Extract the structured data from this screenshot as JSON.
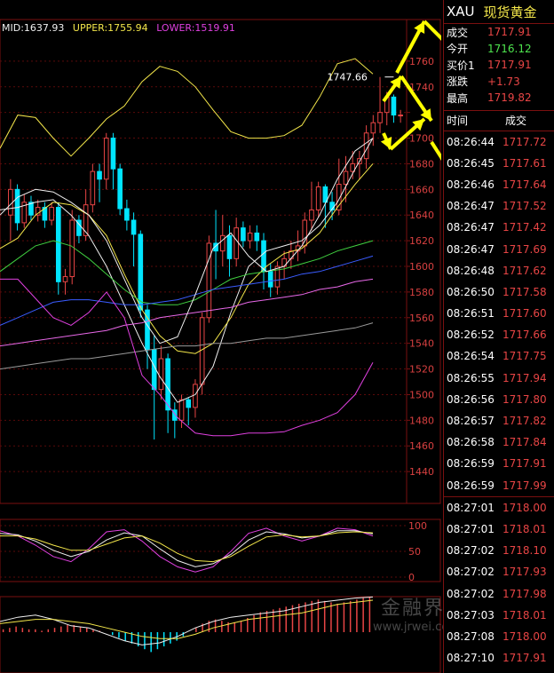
{
  "legend": {
    "mid": "MID:1637.93",
    "upper": "UPPER:1755.94",
    "lower": "LOWER:1519.91",
    "mid_color": "#f0f0f0",
    "upper_color": "#f3e64a",
    "lower_color": "#e040e0"
  },
  "symbol": "XAU",
  "symbol_name": "现货黄金",
  "quote": [
    {
      "label": "成交",
      "value": "1717.91",
      "color": "#e84545"
    },
    {
      "label": "今开",
      "value": "1716.12",
      "color": "#4ee44e"
    },
    {
      "label": "买价1",
      "value": "1717.91",
      "color": "#e84545"
    },
    {
      "label": "涨跌",
      "value": "+1.73",
      "color": "#e84545"
    },
    {
      "label": "最高",
      "value": "1719.82",
      "color": "#e84545"
    }
  ],
  "trades_header": {
    "time": "时间",
    "price": "成交"
  },
  "trades": [
    {
      "time": "08:26:44",
      "price": "1717.72"
    },
    {
      "time": "08:26:45",
      "price": "1717.61"
    },
    {
      "time": "08:26:46",
      "price": "1717.64"
    },
    {
      "time": "08:26:47",
      "price": "1717.52"
    },
    {
      "time": "08:26:47",
      "price": "1717.42"
    },
    {
      "time": "08:26:47",
      "price": "1717.69"
    },
    {
      "time": "08:26:48",
      "price": "1717.62"
    },
    {
      "time": "08:26:50",
      "price": "1717.58"
    },
    {
      "time": "08:26:51",
      "price": "1717.60"
    },
    {
      "time": "08:26:52",
      "price": "1717.66"
    },
    {
      "time": "08:26:54",
      "price": "1717.75"
    },
    {
      "time": "08:26:55",
      "price": "1717.94"
    },
    {
      "time": "08:26:56",
      "price": "1717.80"
    },
    {
      "time": "08:26:57",
      "price": "1717.82"
    },
    {
      "time": "08:26:58",
      "price": "1717.84"
    },
    {
      "time": "08:26:59",
      "price": "1717.91"
    },
    {
      "time": "08:26:59",
      "price": "1717.99"
    },
    {
      "time": "08:27:01",
      "price": "1718.00"
    },
    {
      "time": "08:27:01",
      "price": "1718.01"
    },
    {
      "time": "08:27:02",
      "price": "1718.10"
    },
    {
      "time": "08:27:02",
      "price": "1717.93"
    },
    {
      "time": "08:27:02",
      "price": "1717.98"
    },
    {
      "time": "08:27:03",
      "price": "1718.01"
    },
    {
      "time": "08:27:08",
      "price": "1718.00"
    },
    {
      "time": "08:27:10",
      "price": "1717.91"
    }
  ],
  "watermark": {
    "name": "金融界",
    "url": "www.jrwei.com"
  },
  "chart_data": {
    "type": "candlestick",
    "ylim": [
      1420,
      1780
    ],
    "yticks": [
      1440,
      1460,
      1480,
      1500,
      1520,
      1540,
      1560,
      1580,
      1600,
      1620,
      1640,
      1660,
      1680,
      1700,
      1720,
      1740,
      1760
    ],
    "ytick_labels": [
      "1440",
      "1460",
      "1480",
      "1500",
      "1520",
      "1540",
      "1560",
      "1580",
      "1600",
      "1620",
      "1640",
      "1660",
      "1680",
      "1700",
      "",
      "1740",
      "1760"
    ],
    "high_annotation": {
      "value": 1747.66,
      "label": "1747.66",
      "index": 56
    },
    "colors": {
      "up": "#e84545",
      "down": "#00e5ff",
      "upper": "#f3e64a",
      "mid": "#f0f0f0",
      "lower": "#e040e0"
    },
    "candles": [
      [
        1640,
        1660,
        1620,
        1668
      ],
      [
        1660,
        1634,
        1628,
        1664
      ],
      [
        1634,
        1650,
        1630,
        1656
      ],
      [
        1650,
        1640,
        1636,
        1655
      ],
      [
        1640,
        1646,
        1635,
        1652
      ],
      [
        1646,
        1636,
        1630,
        1650
      ],
      [
        1636,
        1646,
        1632,
        1650
      ],
      [
        1646,
        1588,
        1578,
        1650
      ],
      [
        1588,
        1592,
        1578,
        1598
      ],
      [
        1592,
        1636,
        1586,
        1644
      ],
      [
        1636,
        1624,
        1618,
        1640
      ],
      [
        1624,
        1648,
        1620,
        1660
      ],
      [
        1648,
        1674,
        1642,
        1680
      ],
      [
        1674,
        1668,
        1650,
        1680
      ],
      [
        1668,
        1700,
        1660,
        1704
      ],
      [
        1700,
        1676,
        1660,
        1704
      ],
      [
        1676,
        1645,
        1640,
        1680
      ],
      [
        1645,
        1636,
        1628,
        1652
      ],
      [
        1636,
        1625,
        1600,
        1642
      ],
      [
        1625,
        1566,
        1560,
        1628
      ],
      [
        1566,
        1535,
        1520,
        1570
      ],
      [
        1535,
        1504,
        1465,
        1546
      ],
      [
        1504,
        1528,
        1496,
        1538
      ],
      [
        1528,
        1488,
        1470,
        1532
      ],
      [
        1488,
        1480,
        1466,
        1494
      ],
      [
        1480,
        1496,
        1474,
        1500
      ],
      [
        1496,
        1490,
        1476,
        1498
      ],
      [
        1490,
        1508,
        1482,
        1512
      ],
      [
        1508,
        1560,
        1500,
        1564
      ],
      [
        1560,
        1618,
        1556,
        1624
      ],
      [
        1618,
        1612,
        1590,
        1644
      ],
      [
        1612,
        1624,
        1600,
        1640
      ],
      [
        1624,
        1606,
        1592,
        1632
      ],
      [
        1606,
        1630,
        1600,
        1638
      ],
      [
        1630,
        1620,
        1615,
        1635
      ],
      [
        1620,
        1626,
        1614,
        1632
      ],
      [
        1626,
        1620,
        1612,
        1632
      ],
      [
        1620,
        1596,
        1582,
        1626
      ],
      [
        1596,
        1584,
        1576,
        1602
      ],
      [
        1584,
        1600,
        1578,
        1604
      ],
      [
        1600,
        1606,
        1590,
        1612
      ],
      [
        1606,
        1612,
        1598,
        1620
      ],
      [
        1612,
        1616,
        1604,
        1628
      ],
      [
        1616,
        1636,
        1610,
        1642
      ],
      [
        1636,
        1644,
        1628,
        1666
      ],
      [
        1644,
        1662,
        1638,
        1666
      ],
      [
        1662,
        1650,
        1630,
        1664
      ],
      [
        1650,
        1644,
        1636,
        1658
      ],
      [
        1644,
        1664,
        1640,
        1684
      ],
      [
        1664,
        1674,
        1650,
        1686
      ],
      [
        1674,
        1680,
        1668,
        1690
      ],
      [
        1680,
        1684,
        1668,
        1690
      ],
      [
        1684,
        1704,
        1676,
        1710
      ],
      [
        1704,
        1712,
        1694,
        1718
      ],
      [
        1712,
        1720,
        1704,
        1747.66
      ],
      [
        1720,
        1732,
        1710,
        1736
      ],
      [
        1732,
        1718,
        1712,
        1734
      ],
      [
        1718,
        1718,
        1712,
        1722
      ]
    ],
    "bands": {
      "upper": [
        1692,
        1718,
        1716,
        1700,
        1686,
        1700,
        1715,
        1725,
        1744,
        1756,
        1752,
        1740,
        1722,
        1705,
        1700,
        1700,
        1702,
        1710,
        1732,
        1758,
        1762,
        1750
      ],
      "mid": [
        1640,
        1654,
        1660,
        1658,
        1650,
        1640,
        1620,
        1590,
        1560,
        1540,
        1545,
        1578,
        1614,
        1626,
        1608,
        1596,
        1600,
        1616,
        1640,
        1668,
        1690,
        1700
      ],
      "lower": [
        1590,
        1590,
        1575,
        1560,
        1554,
        1564,
        1580,
        1560,
        1515,
        1500,
        1482,
        1470,
        1468,
        1468,
        1470,
        1470,
        1471,
        1476,
        1480,
        1486,
        1500,
        1525
      ]
    },
    "ma_lines": [
      {
        "color": "#f0f0f0",
        "values": [
          1644,
          1646,
          1650,
          1652,
          1640,
          1624,
          1600,
          1570,
          1540,
          1514,
          1494,
          1500,
          1522,
          1564,
          1600,
          1612,
          1616,
          1620,
          1632,
          1650,
          1676,
          1700
        ]
      },
      {
        "color": "#f3e64a",
        "values": [
          1614,
          1622,
          1640,
          1650,
          1648,
          1640,
          1624,
          1594,
          1566,
          1546,
          1534,
          1532,
          1540,
          1560,
          1586,
          1600,
          1610,
          1614,
          1626,
          1646,
          1664,
          1680
        ]
      },
      {
        "color": "#40d040",
        "values": [
          1596,
          1606,
          1616,
          1620,
          1616,
          1606,
          1594,
          1582,
          1572,
          1570,
          1570,
          1574,
          1582,
          1590,
          1594,
          1596,
          1598,
          1602,
          1606,
          1612,
          1616,
          1620
        ]
      },
      {
        "color": "#3a5cff",
        "values": [
          1554,
          1560,
          1566,
          1572,
          1574,
          1574,
          1572,
          1570,
          1570,
          1572,
          1574,
          1578,
          1582,
          1584,
          1586,
          1588,
          1590,
          1594,
          1596,
          1600,
          1604,
          1608
        ]
      },
      {
        "color": "#e868e8",
        "values": [
          1538,
          1540,
          1542,
          1544,
          1546,
          1548,
          1550,
          1554,
          1556,
          1560,
          1562,
          1564,
          1566,
          1568,
          1572,
          1574,
          1576,
          1578,
          1582,
          1584,
          1588,
          1590
        ]
      },
      {
        "color": "#9a9a9a",
        "values": [
          1520,
          1522,
          1524,
          1526,
          1528,
          1528,
          1530,
          1532,
          1534,
          1536,
          1538,
          1538,
          1540,
          1540,
          1542,
          1544,
          1544,
          1546,
          1548,
          1550,
          1552,
          1556
        ]
      }
    ],
    "osc_ticks": [
      {
        "value": 100,
        "label": "100"
      },
      {
        "value": 50,
        "label": "50"
      },
      {
        "value": 0,
        "label": "0"
      }
    ],
    "osc_lines": [
      {
        "color": "#e040e0",
        "values": [
          90,
          80,
          62,
          40,
          30,
          55,
          88,
          92,
          70,
          40,
          20,
          10,
          20,
          50,
          85,
          95,
          80,
          70,
          80,
          95,
          92,
          80
        ]
      },
      {
        "color": "#f0f0f0",
        "values": [
          85,
          82,
          70,
          52,
          40,
          50,
          72,
          86,
          80,
          55,
          32,
          20,
          26,
          44,
          72,
          88,
          84,
          76,
          80,
          90,
          90,
          84
        ]
      },
      {
        "color": "#f3e64a",
        "values": [
          80,
          80,
          74,
          62,
          52,
          52,
          64,
          76,
          80,
          66,
          46,
          32,
          30,
          40,
          60,
          78,
          82,
          78,
          80,
          86,
          88,
          86
        ]
      }
    ],
    "macd": [
      2,
      3,
      4,
      3,
      2,
      2,
      1,
      2,
      3,
      4,
      5,
      5,
      4,
      3,
      2,
      1,
      0,
      -2,
      -4,
      -6,
      -8,
      -10,
      -12,
      -14,
      -12,
      -10,
      -8,
      -6,
      -3,
      0,
      3,
      6,
      8,
      9,
      8,
      7,
      7,
      8,
      10,
      12,
      14,
      15,
      16,
      17,
      18,
      19,
      20,
      21,
      22,
      23,
      22,
      21,
      20,
      21,
      22,
      23,
      24,
      25
    ],
    "macd_lines": [
      {
        "color": "#f0f0f0",
        "values": [
          10,
          14,
          16,
          12,
          6,
          4,
          -2,
          -8,
          -12,
          -10,
          -4,
          4,
          10,
          14,
          16,
          18,
          20,
          24,
          28,
          30,
          32,
          33
        ]
      },
      {
        "color": "#f3e64a",
        "values": [
          8,
          10,
          12,
          12,
          10,
          8,
          4,
          0,
          -4,
          -6,
          -6,
          -2,
          4,
          8,
          12,
          14,
          16,
          18,
          22,
          26,
          28,
          30
        ]
      }
    ]
  }
}
